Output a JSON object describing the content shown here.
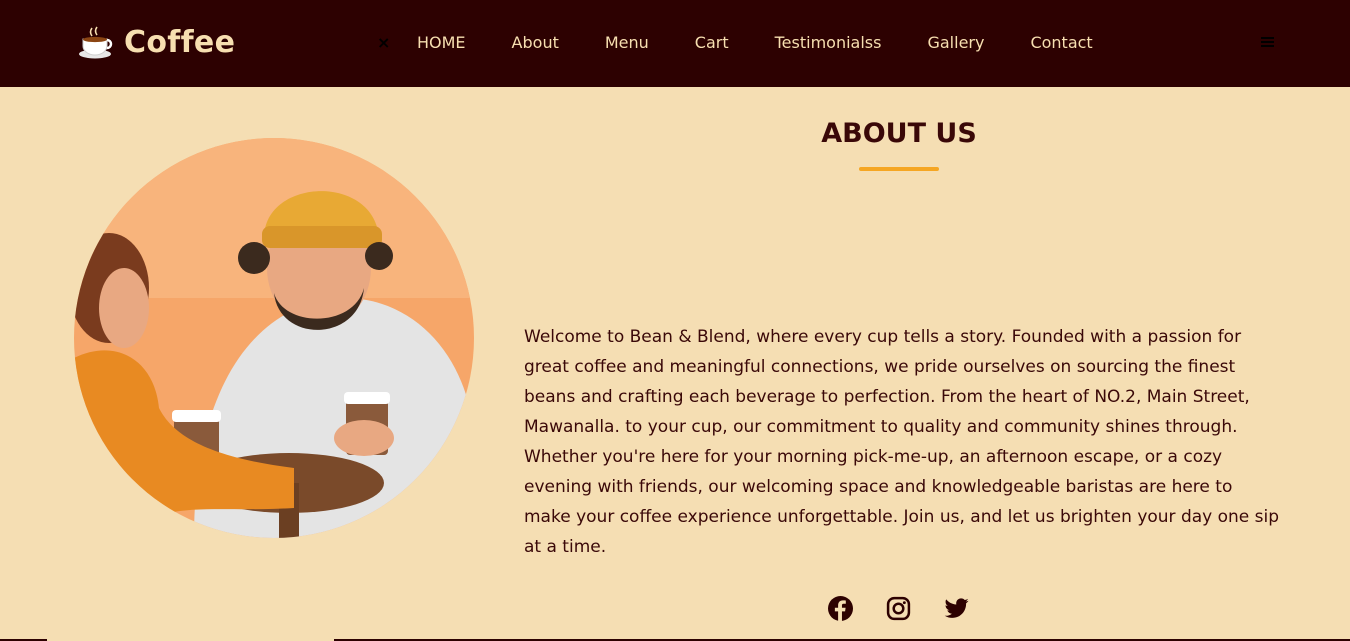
{
  "brand": {
    "name": "Coffee",
    "logo_icon": "coffee-cup-icon"
  },
  "nav": {
    "close_symbol": "×",
    "items": [
      {
        "label": "HOME"
      },
      {
        "label": "About"
      },
      {
        "label": "Menu"
      },
      {
        "label": "Cart"
      },
      {
        "label": "Testimonialss"
      },
      {
        "label": "Gallery"
      },
      {
        "label": "Contact"
      }
    ],
    "menu_icon": "hamburger-menu-icon"
  },
  "about": {
    "title": "ABOUT US",
    "body": "Welcome to Bean & Blend, where every cup tells a story. Founded with a passion for great coffee and meaningful connections, we pride ourselves on sourcing the finest beans and crafting each beverage to perfection. From the heart of NO.2, Main Street, Mawanalla. to your cup, our commitment to quality and community shines through. Whether you're here for your morning pick-me-up, an afternoon escape, or a cozy evening with friends, our welcoming space and knowledgeable baristas are here to make your coffee experience unforgettable. Join us, and let us brighten your day one sip at a time.",
    "image": "couple-with-coffee-cups-photo"
  },
  "socials": [
    "facebook-icon",
    "instagram-icon",
    "twitter-icon"
  ],
  "colors": {
    "nav_bg": "#2d0101",
    "page_bg": "#f5deb3",
    "accent": "#f5a623",
    "text": "#3a0808",
    "nav_text": "#f7dfb0"
  }
}
